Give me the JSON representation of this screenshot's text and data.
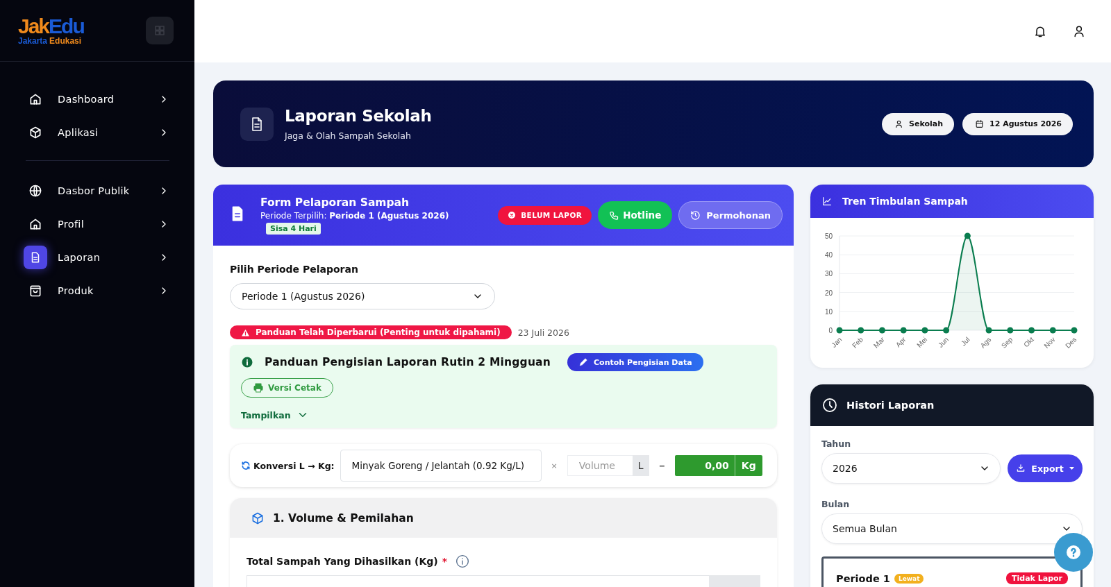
{
  "logo": {
    "mark_start": "Jak",
    "mark_end": "Edu",
    "subtitle_start": "Jakarta",
    "subtitle_end": "Edukasi"
  },
  "sidebar": {
    "groups": [
      {
        "items": [
          {
            "label": "Dashboard",
            "selected": false
          },
          {
            "label": "Aplikasi",
            "selected": false
          }
        ]
      },
      {
        "items": [
          {
            "label": "Dasbor Publik",
            "selected": false
          },
          {
            "label": "Profil",
            "selected": false
          },
          {
            "label": "Laporan",
            "selected": true
          },
          {
            "label": "Produk",
            "selected": false
          }
        ]
      }
    ]
  },
  "banner": {
    "title": "Laporan Sekolah",
    "subtitle": "Jaga & Olah Sampah Sekolah",
    "chips": [
      {
        "label": "Sekolah"
      },
      {
        "label": "12 Agustus 2026"
      }
    ]
  },
  "form": {
    "title": "Form Pelaporan Sampah",
    "period_line": "Periode Terpilih: **Periode 1 (Agustus 2026)**",
    "remaining": "Sisa 4 Hari",
    "status": "BELUM LAPOR",
    "hotline": "Hotline",
    "request": "Permohonan",
    "period_label": "Pilih Periode Pelaporan",
    "period_value": "Periode 1 (Agustus 2026)",
    "notice": "Panduan Telah Diperbarui (Penting untuk dipahami)",
    "notice_date": "23 Juli 2026",
    "guide": {
      "title": "Panduan Pengisian Laporan Rutin 2 Mingguan",
      "example": "Contoh Pengisian Data",
      "print": "Versi Cetak",
      "toggle": "Tampilkan",
      "expanded": false
    },
    "converter": {
      "label": "Konversi L → Kg:",
      "material": "Minyak Goreng / Jelantah (0.92 Kg/L)",
      "times": "×",
      "volume_placeholder": "Volume",
      "volume_unit": "L",
      "equals": "=",
      "result": "0,00",
      "result_unit": "Kg"
    },
    "section": {
      "title": "1. Volume & Pemilahan",
      "field_label": "Total Sampah Yang Dihasilkan (Kg)",
      "required": "*"
    }
  },
  "trend": {
    "title": "Tren Timbulan Sampah",
    "chart_data": {
      "type": "area",
      "categories": [
        "Jan",
        "Feb",
        "Mar",
        "Apr",
        "Mei",
        "Jun",
        "Jul",
        "Ags",
        "Sep",
        "Okt",
        "Nov",
        "Des"
      ],
      "grid": true,
      "series": [
        {
          "color": "#0a7d4f",
          "values": [
            0,
            0,
            0,
            0,
            0,
            0,
            50,
            0,
            0,
            0,
            0,
            0
          ]
        }
      ],
      "ylim": [
        0,
        50
      ],
      "yticks": [
        0,
        10,
        20,
        30,
        40,
        50
      ]
    }
  },
  "history": {
    "title": "Histori Laporan",
    "year_label": "Tahun",
    "year_value": "2026",
    "export": "Export",
    "month_label": "Bulan",
    "month_value": "Semua Bulan",
    "entries": [
      {
        "period": "Periode 1",
        "tag": "Lewat",
        "status": "Tidak Lapor"
      }
    ]
  }
}
